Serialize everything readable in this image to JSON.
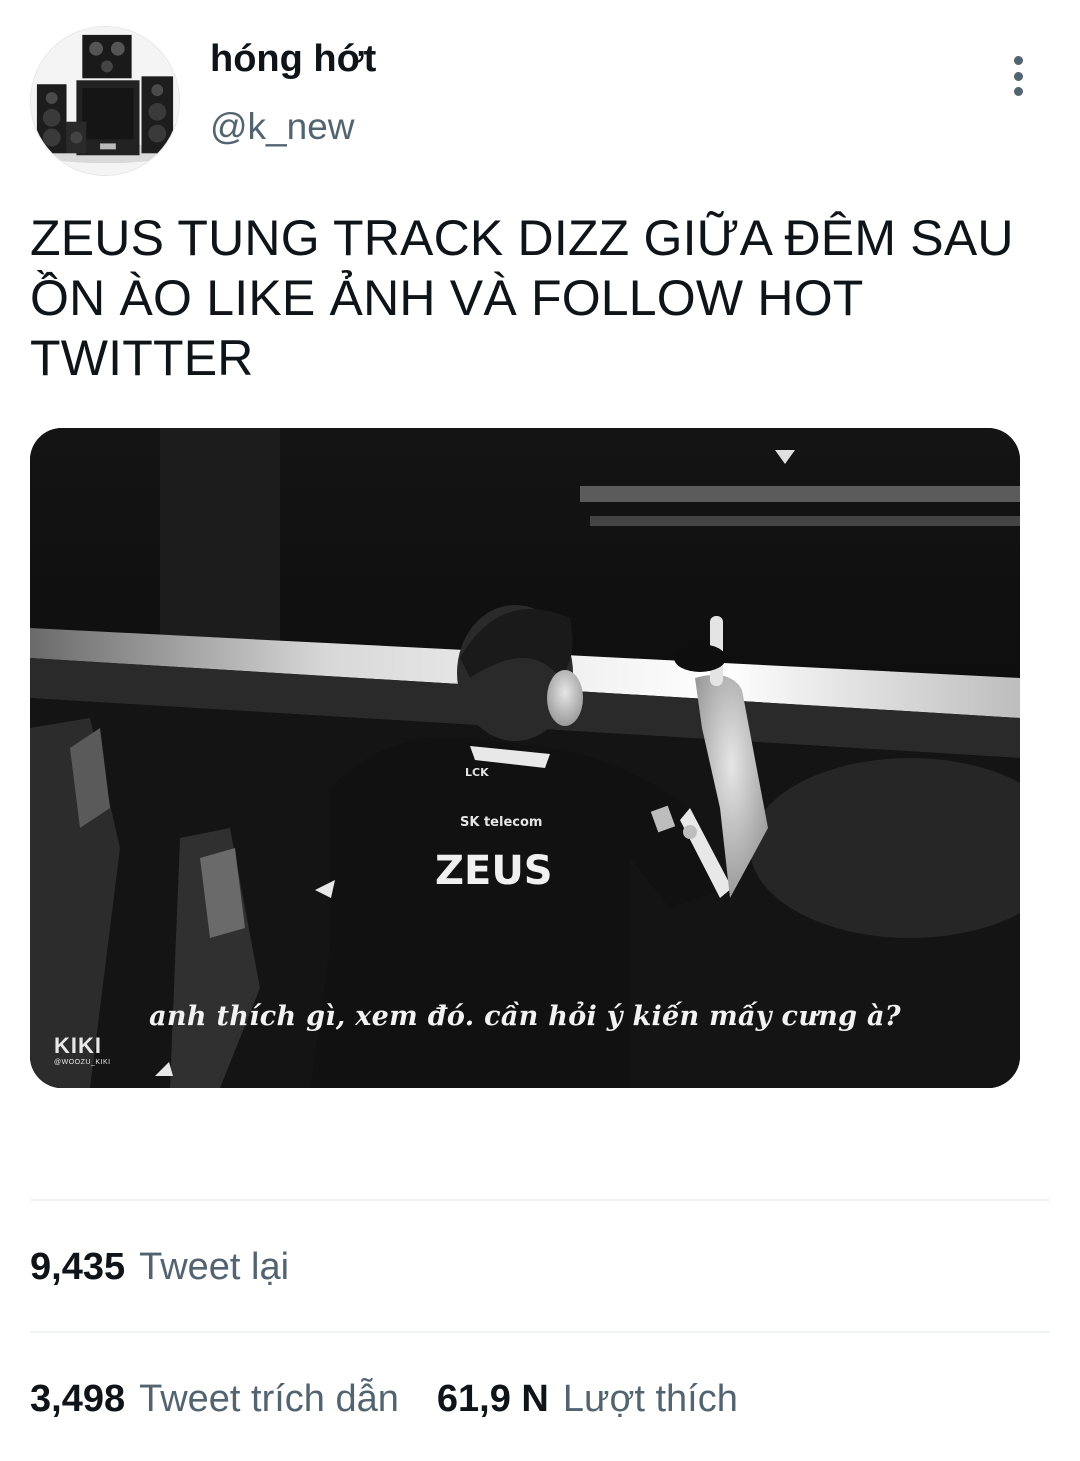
{
  "author": {
    "display_name": "hóng hớt",
    "handle": "@k_new",
    "avatar_icon": "speaker-set-avatar"
  },
  "menu": {
    "icon": "more-vertical-icon"
  },
  "tweet": {
    "lines": [
      "ZEUS TUNG TRACK DIZZ GIỮA ĐÊM SAU",
      "ỒN ÀO LIKE ẢNH VÀ FOLLOW HOT",
      "TWITTER"
    ]
  },
  "media": {
    "jersey_text": "ZEUS",
    "sponsor_text": "SK telecom",
    "league_text": "LCK",
    "caption": "anh thích gì, xem đó. cần hỏi ý kiến mấy cưng à?",
    "watermark": "KIKI",
    "watermark_sub": "@WOOZU_KIKI"
  },
  "stats": {
    "retweets": {
      "count": "9,435",
      "label": "Tweet lại"
    },
    "quotes": {
      "count": "3,498",
      "label": "Tweet trích dẫn"
    },
    "likes": {
      "count": "61,9 N",
      "label": "Lượt thích"
    }
  },
  "colors": {
    "text_primary": "#0f1419",
    "text_secondary": "#536471",
    "divider": "#eff3f4"
  }
}
